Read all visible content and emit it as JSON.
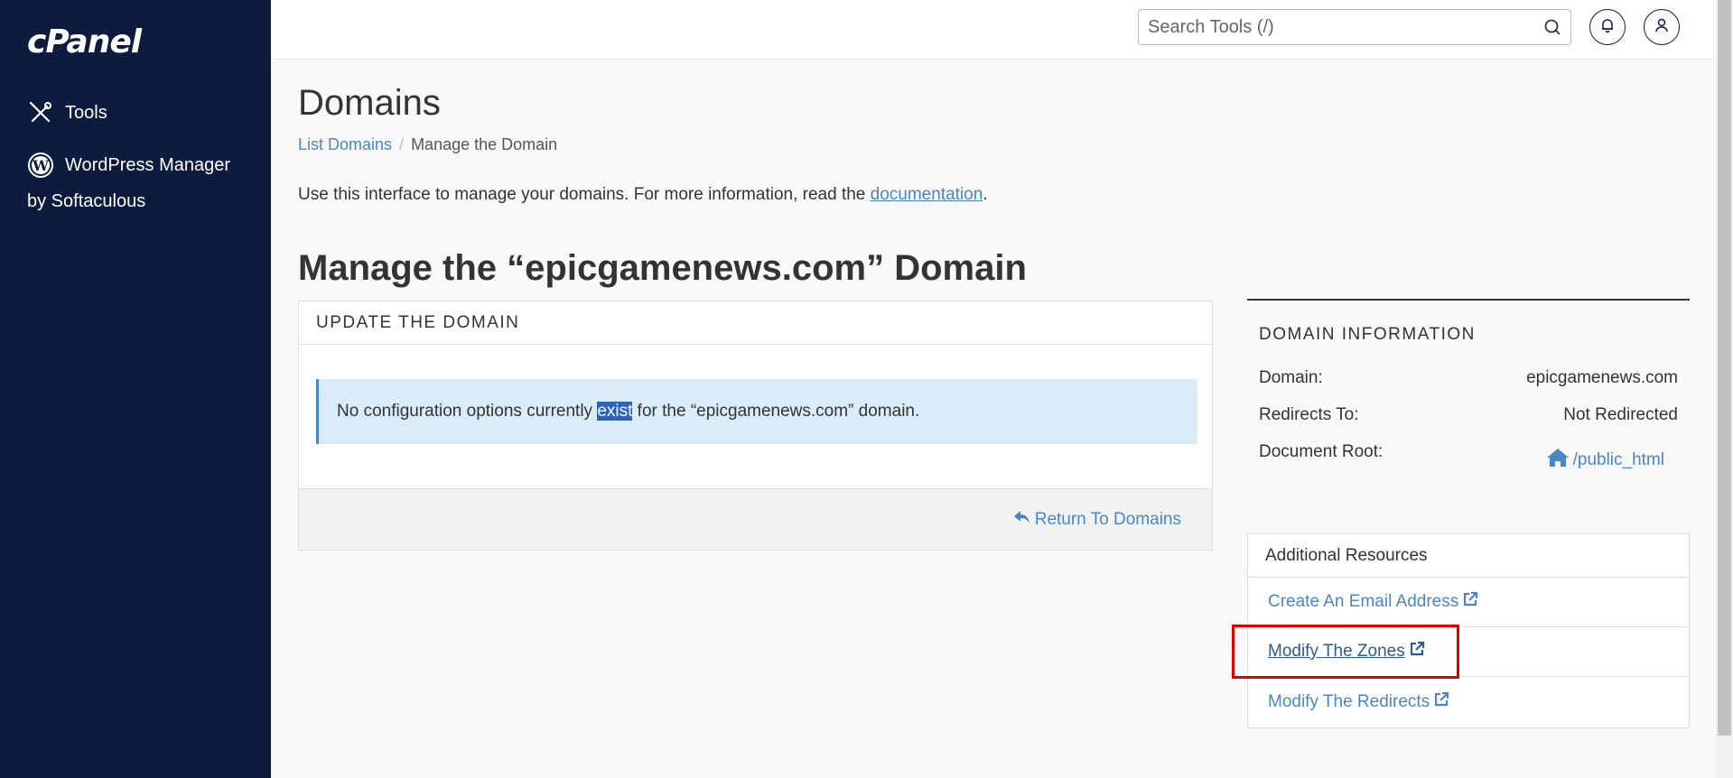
{
  "sidebar": {
    "logo": "cPanel",
    "items": [
      {
        "label": "Tools",
        "icon": "tools-icon"
      },
      {
        "label": "WordPress Manager",
        "sublabel": "by Softaculous",
        "icon": "wordpress-icon"
      }
    ]
  },
  "topbar": {
    "search_placeholder": "Search Tools (/)",
    "icons": [
      "search-icon",
      "bell-icon",
      "user-icon"
    ]
  },
  "page": {
    "title": "Domains",
    "breadcrumb": [
      "List Domains",
      "Manage the Domain"
    ],
    "intro_text": "Use this interface to manage your domains. For more information, read the ",
    "intro_link": "documentation",
    "intro_end": ".",
    "section_title": "Manage the “epicgamenews.com” Domain"
  },
  "update_panel": {
    "heading": "UPDATE THE DOMAIN",
    "alert_before": "No configuration options currently ",
    "alert_highlight": "exist",
    "alert_after": " for the “epicgamenews.com” domain.",
    "return_label": "Return To Domains"
  },
  "domain_info": {
    "heading": "DOMAIN INFORMATION",
    "rows": [
      {
        "label": "Domain:",
        "value": "epicgamenews.com"
      },
      {
        "label": "Redirects To:",
        "value": "Not Redirected"
      },
      {
        "label": "Document Root:",
        "value": "/public_html"
      }
    ]
  },
  "resources": {
    "heading": "Additional Resources",
    "links": [
      "Create An Email Address",
      "Modify The Zones",
      "Modify The Redirects"
    ]
  },
  "colors": {
    "sidebar_bg": "#0d1b3e",
    "link": "#4a86c5",
    "alert_bg": "#d9ecf8",
    "highlight": "#2a63c4",
    "annotation_red": "#e00000"
  }
}
